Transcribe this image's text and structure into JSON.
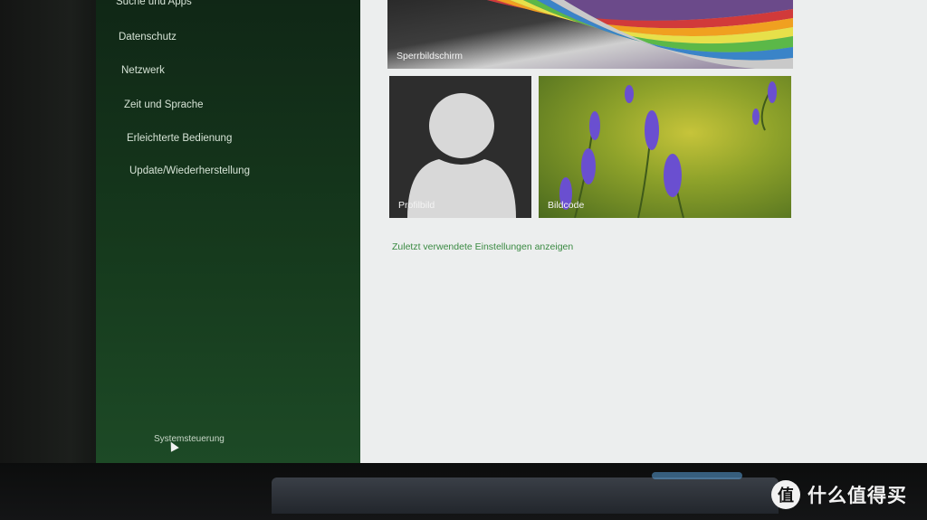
{
  "sidebar": {
    "items": [
      {
        "label": "Suche und Apps"
      },
      {
        "label": "Datenschutz"
      },
      {
        "label": "Netzwerk"
      },
      {
        "label": "Zeit und Sprache"
      },
      {
        "label": "Erleichterte Bedienung"
      },
      {
        "label": "Update/Wiederherstellung"
      }
    ],
    "footer_link": "Systemsteuerung"
  },
  "tiles": {
    "lock_screen": "Sperrbildschirm",
    "profile_picture": "Profilbild",
    "picture_password": "Bildcode"
  },
  "recent_settings_link": "Zuletzt verwendete Einstellungen anzeigen",
  "watermark": {
    "badge": "值",
    "text": "什么值得买"
  },
  "colors": {
    "sidebar": "#163a1d",
    "content_bg": "#eceeee",
    "link": "#3a8a42"
  }
}
